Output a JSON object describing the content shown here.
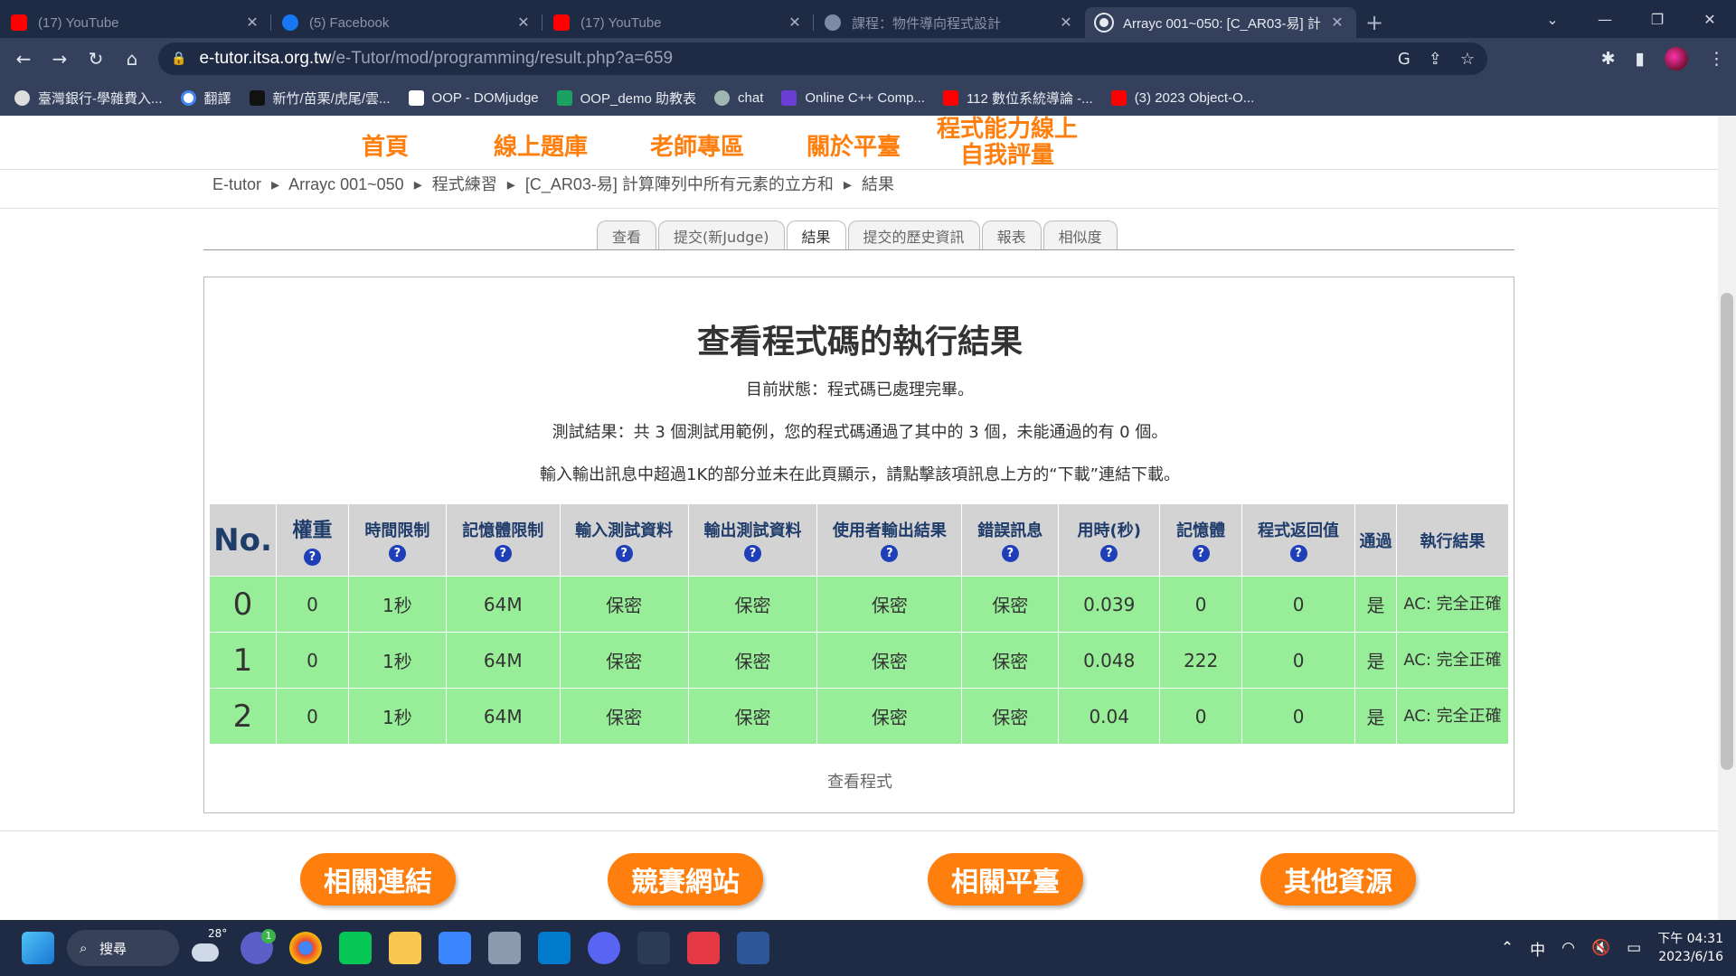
{
  "browser": {
    "tabs": [
      {
        "title": "(17) YouTube",
        "icon": "youtube-icon",
        "active": false
      },
      {
        "title": "(5) Facebook",
        "icon": "facebook-icon",
        "active": false
      },
      {
        "title": "(17) YouTube",
        "icon": "youtube-icon",
        "active": false
      },
      {
        "title": "課程：物件導向程式設計",
        "icon": "gear-icon",
        "active": false
      },
      {
        "title": "Arrayc 001~050: [C_AR03-易] 計",
        "icon": "site-icon",
        "active": true
      }
    ],
    "new_tab": "+",
    "url_host": "e-tutor.itsa.org.tw",
    "url_path": "/e-Tutor/mod/programming/result.php?a=659",
    "bookmarks": [
      "臺灣銀行-學雜費入...",
      "翻譯",
      "新竹/苗栗/虎尾/雲...",
      "OOP - DOMjudge",
      "OOP_demo 助教表",
      "chat",
      "Online C++ Comp...",
      "112 數位系統導論 -...",
      "(3) 2023 Object-O..."
    ]
  },
  "site": {
    "nav": [
      "首頁",
      "線上題庫",
      "老師專區",
      "關於平臺",
      "程式能力線上",
      "自我評量"
    ],
    "breadcrumb": [
      "E-tutor",
      "▸",
      "Arrayc 001~050",
      "▸",
      "程式練習",
      "▸",
      "[C_AR03-易] 計算陣列中所有元素的立方和",
      "▸",
      "結果"
    ],
    "subtabs": [
      "查看",
      "提交(新Judge)",
      "結果",
      "提交的歷史資訊",
      "報表",
      "相似度"
    ],
    "active_subtab": "結果"
  },
  "result": {
    "title": "查看程式碼的執行結果",
    "status": "目前狀態：程式碼已處理完畢。",
    "summary": "測試結果：共 3 個測試用範例，您的程式碼通過了其中的 3 個，未能通過的有 0 個。",
    "note": "輸入輸出訊息中超過1K的部分並未在此頁顯示，請點擊該項訊息上方的“下載”連結下載。",
    "headers": [
      "No.",
      "權重",
      "時間限制",
      "記憶體限制",
      "輸入測試資料",
      "輸出測試資料",
      "使用者輸出結果",
      "錯誤訊息",
      "用時(秒)",
      "記憶體",
      "程式返回值",
      "通過",
      "執行結果"
    ],
    "rows": [
      [
        "0",
        "0",
        "1秒",
        "64M",
        "保密",
        "保密",
        "保密",
        "保密",
        "0.039",
        "0",
        "0",
        "是",
        "AC: 完全正確"
      ],
      [
        "1",
        "0",
        "1秒",
        "64M",
        "保密",
        "保密",
        "保密",
        "保密",
        "0.048",
        "222",
        "0",
        "是",
        "AC: 完全正確"
      ],
      [
        "2",
        "0",
        "1秒",
        "64M",
        "保密",
        "保密",
        "保密",
        "保密",
        "0.04",
        "0",
        "0",
        "是",
        "AC: 完全正確"
      ]
    ],
    "view_code": "查看程式"
  },
  "footer_buttons": [
    "相關連結",
    "競賽網站",
    "相關平臺",
    "其他資源"
  ],
  "taskbar": {
    "search": "搜尋",
    "weather": "28°",
    "badge": "1",
    "ime": "中",
    "time": "下午 04:31",
    "date": "2023/6/16"
  },
  "colors": {
    "brand_orange": "#ff7f0e",
    "pass_green": "#98ee98",
    "header_gray": "#d3d3d3"
  }
}
